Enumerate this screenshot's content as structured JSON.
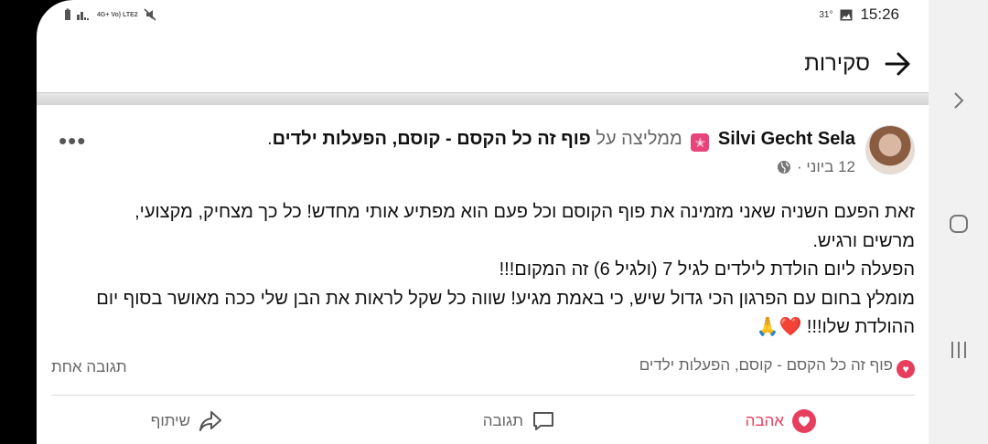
{
  "status_bar": {
    "network": "4G+ Vo) LTE2",
    "temperature": "31°",
    "time": "15:26"
  },
  "header": {
    "title": "סקירות"
  },
  "post": {
    "author": "Silvi Gecht Sela",
    "recommends_text": "ממליצה על",
    "page_name": "פוף זה כל הקסם - קוסם, הפעלות ילדים",
    "page_suffix": ".",
    "date": "12 ביוני ·",
    "more_label": "•••",
    "body_lines": [
      "זאת הפעם השניה שאני מזמינה את פוף הקוסם וכל פעם הוא מפתיע אותי מחדש! כל כך מצחיק, מקצועי,",
      "מרשים ורגיש.",
      "הפעלה ליום הולדת לילדים לגיל 7 (ולגיל 6) זה המקום!!!",
      "מומלץ בחום עם הפרגון הכי גדול שיש, כי באמת מגיע! שווה כל שקל לראות את הבן שלי ככה מאושר בסוף יום",
      "ההולדת שלו!!! ❤️🙏"
    ],
    "reaction_page": "פוף זה כל הקסם - קוסם, הפעלות ילדים",
    "reply_count": "תגובה אחת"
  },
  "actions": {
    "love": "אהבה",
    "comment": "תגובה",
    "share": "שיתוף"
  },
  "colors": {
    "accent": "#e83e5d",
    "badge": "#e8437a"
  }
}
